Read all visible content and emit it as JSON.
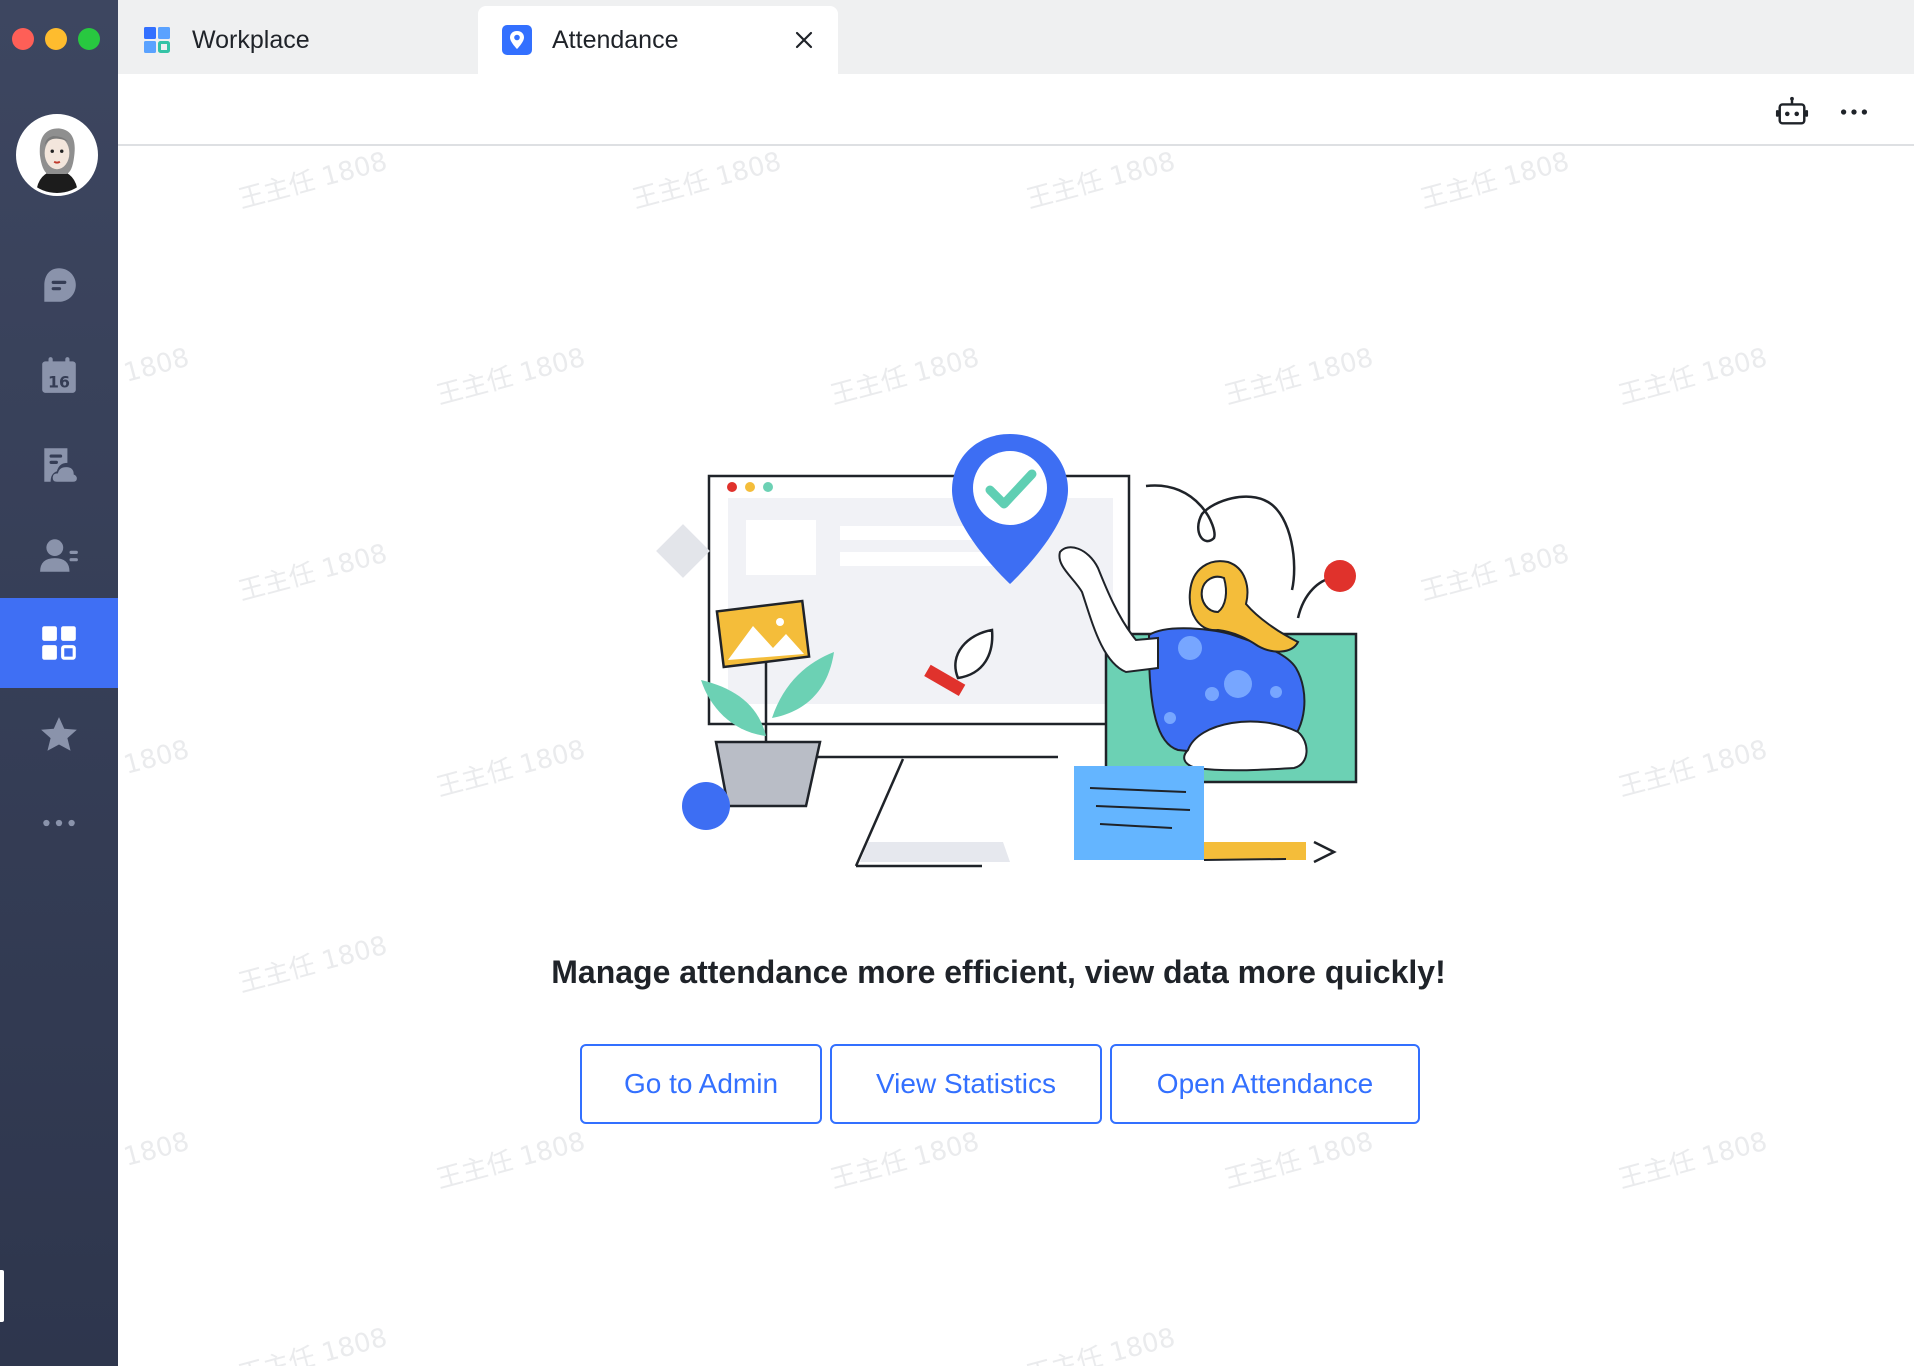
{
  "window": {
    "controls": [
      "close",
      "minimize",
      "maximize"
    ]
  },
  "sidebar": {
    "avatar": "user-avatar",
    "items": [
      {
        "name": "messages",
        "icon": "chat-bubble-icon",
        "active": false
      },
      {
        "name": "calendar",
        "icon": "calendar-icon",
        "label": "16",
        "active": false
      },
      {
        "name": "docs",
        "icon": "cloud-doc-icon",
        "active": false
      },
      {
        "name": "contacts",
        "icon": "contacts-icon",
        "active": false
      },
      {
        "name": "workplace",
        "icon": "apps-grid-icon",
        "active": true
      },
      {
        "name": "favorites",
        "icon": "star-icon",
        "active": false
      },
      {
        "name": "more",
        "icon": "more-horizontal-icon",
        "active": false
      }
    ]
  },
  "tabs": [
    {
      "label": "Workplace",
      "icon": "apps-grid-icon",
      "active": false
    },
    {
      "label": "Attendance",
      "icon": "location-pin-icon",
      "active": true,
      "closable": true
    }
  ],
  "header": {
    "actions": [
      "bot-icon",
      "more-icon"
    ]
  },
  "watermark": "王主任 1808",
  "main": {
    "headline": "Manage attendance more efficient, view data more quickly!",
    "buttons": [
      {
        "label": "Go to Admin"
      },
      {
        "label": "View Statistics"
      },
      {
        "label": "Open Attendance"
      }
    ]
  },
  "colors": {
    "accent": "#3370ff",
    "sidebar_active": "#3f6ff4",
    "sidebar_bg": "#353d55"
  }
}
